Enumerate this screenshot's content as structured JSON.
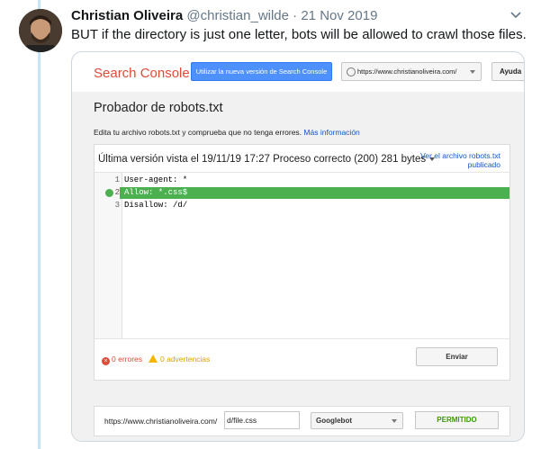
{
  "tweet": {
    "author_name": "Christian Oliveira",
    "handle": "@christian_wilde",
    "separator": "·",
    "date": "21 Nov 2019",
    "text": "BUT if the directory is just one letter, bots will be allowed to crawl those files."
  },
  "screenshot": {
    "header": {
      "brand": "Search Console",
      "new_version_button": "Utilizar la nueva versión de Search Console",
      "site_selector": "https://www.christianoliveira.com/",
      "help_button": "Ayuda"
    },
    "page": {
      "title": "Probador de robots.txt",
      "description": "Edita tu archivo robots.txt y comprueba que no tenga errores.",
      "more_info_link": "Más información"
    },
    "version": {
      "text": "Última versión vista el 19/11/19 17:27 Proceso correcto (200) 281 bytes",
      "view_published_link": "Ver el archivo robots.txt publicado"
    },
    "code_lines": [
      {
        "num": "1",
        "text": "User-agent: *"
      },
      {
        "num": "2",
        "text": "Allow: *.css$"
      },
      {
        "num": "3",
        "text": "Disallow: /d/"
      }
    ],
    "status": {
      "errors": "0 errores",
      "warnings": "0 advertencias",
      "submit_button": "Enviar"
    },
    "test": {
      "url_prefix": "https://www.christianoliveira.com/",
      "url_path": "d/file.css",
      "user_agent": "Googlebot",
      "result": "PERMITIDO"
    }
  },
  "colors": {
    "brand_red": "#dd4b39",
    "link_blue": "#1155cc",
    "highlight_green": "#4caf50",
    "allowed_green": "#3d9a00",
    "thread_line": "#c7e4f7"
  }
}
